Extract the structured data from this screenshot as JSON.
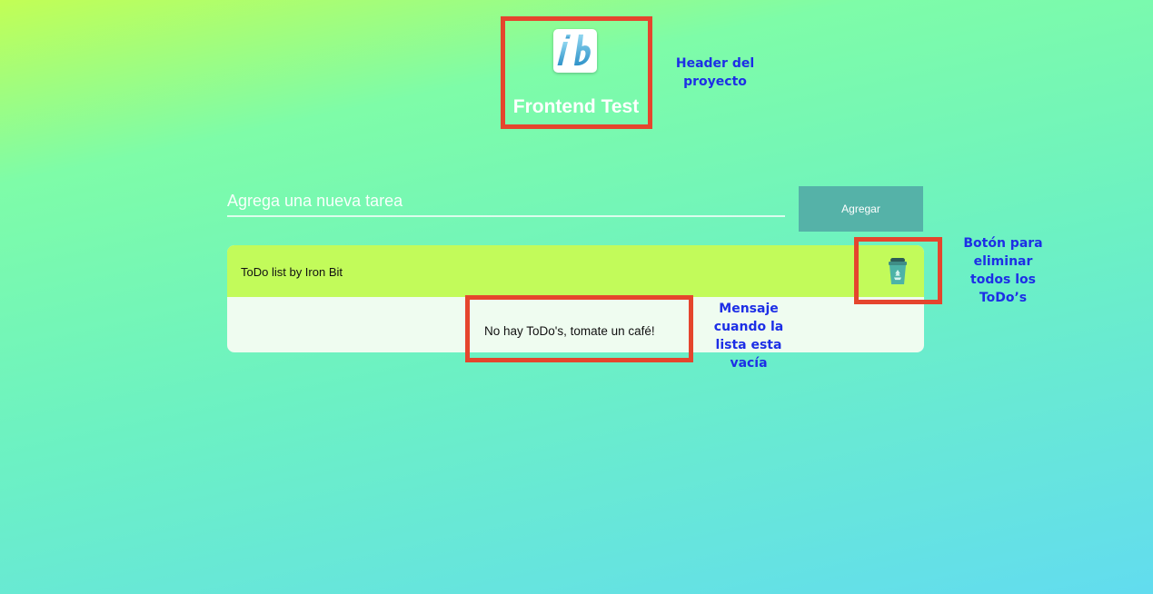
{
  "header": {
    "title": "Frontend Test"
  },
  "form": {
    "placeholder": "Agrega una nueva tarea",
    "add_label": "Agregar"
  },
  "todo_card": {
    "title": "ToDo list by Iron Bit",
    "empty_message": "No hay ToDo's, tomate un café!"
  },
  "annotations": {
    "header_note": "Header del proyecto",
    "delete_all_note": "Botón para eliminar todos los ToDo’s",
    "empty_note": "Mensaje cuando la lista esta vacía"
  },
  "icons": {
    "logo": "ib-logo-icon",
    "delete_all": "recycle-bin-icon"
  },
  "colors": {
    "annotation_box": "#e5452d",
    "annotation_text": "#1d2ee6",
    "card_header": "#c2fb5a",
    "button": "#55b2a8"
  }
}
